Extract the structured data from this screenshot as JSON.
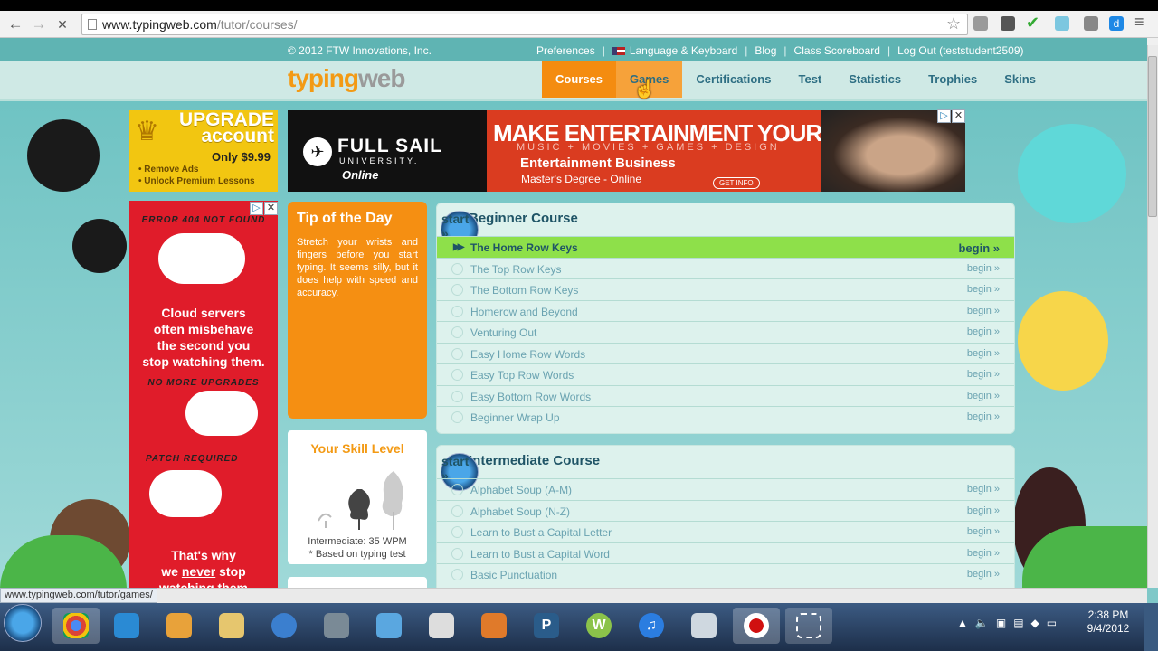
{
  "browser": {
    "url_host": "www.typingweb.com",
    "url_path": "/tutor/courses/",
    "back": "←",
    "forward": "→",
    "stop": "✕",
    "status_url": "www.typingweb.com/tutor/games/"
  },
  "meta_bar": {
    "copyright": "© 2012 FTW Innovations, Inc.",
    "links": [
      "Preferences",
      "Language & Keyboard",
      "Blog",
      "Class Scoreboard",
      "Log Out (teststudent2509)"
    ]
  },
  "logo": {
    "part1": "typing",
    "part2": "web"
  },
  "nav": [
    "Courses",
    "Games",
    "Certifications",
    "Test",
    "Statistics",
    "Trophies",
    "Skins"
  ],
  "upgrade": {
    "title_line1": "UPGRADE",
    "title_line2": "account",
    "price": "Only $9.99",
    "perk1": "Remove Ads",
    "perk2": "Unlock Premium Lessons"
  },
  "banner": {
    "brand": "FULL SAIL",
    "university": "UNIVERSITY.",
    "online": "Online",
    "headline": "MAKE ENTERTAINMENT YOUR BUSINESS",
    "subhead": "MUSIC + MOVIES + GAMES + DESIGN",
    "program": "Entertainment Business",
    "degree": "Master's Degree - Online",
    "cta": "GET INFO"
  },
  "red_ad": {
    "error404": "ERROR 404 NOT FOUND",
    "line1": "Cloud servers",
    "line2": "often misbehave",
    "line3": "the second you",
    "line4": "stop watching them.",
    "no_upgrades": "NO MORE UPGRADES",
    "patch": "PATCH REQUIRED",
    "bottom1": "That's why",
    "bottom2_a": "we ",
    "bottom2_b": "never",
    "bottom2_c": " stop",
    "bottom3": "watching them"
  },
  "tip": {
    "title": "Tip of the Day",
    "text": "Stretch your wrists and fingers before you start typing. It seems silly, but it does help with speed and accuracy."
  },
  "skill": {
    "title": "Your Skill Level",
    "level": "Intermediate: 35 WPM",
    "note": "* Based on typing test"
  },
  "beginner": {
    "title": "Beginner Course",
    "start": "start »",
    "begin": "begin »",
    "lessons": [
      "The Home Row Keys",
      "The Top Row Keys",
      "The Bottom Row Keys",
      "Homerow and Beyond",
      "Venturing Out",
      "Easy Home Row Words",
      "Easy Top Row Words",
      "Easy Bottom Row Words",
      "Beginner Wrap Up"
    ]
  },
  "intermediate": {
    "title": "Intermediate Course",
    "start": "start »",
    "begin": "begin »",
    "lessons": [
      "Alphabet Soup (A-M)",
      "Alphabet Soup (N-Z)",
      "Learn to Bust a Capital Letter",
      "Learn to Bust a Capital Word",
      "Basic Punctuation"
    ]
  },
  "taskbar": {
    "time": "2:38 PM",
    "date": "9/4/2012"
  },
  "colors": {
    "orange": "#f48c10",
    "teal_text": "#1f5466",
    "current_lesson": "#8ee04a",
    "red_ad": "#e01c2a"
  }
}
